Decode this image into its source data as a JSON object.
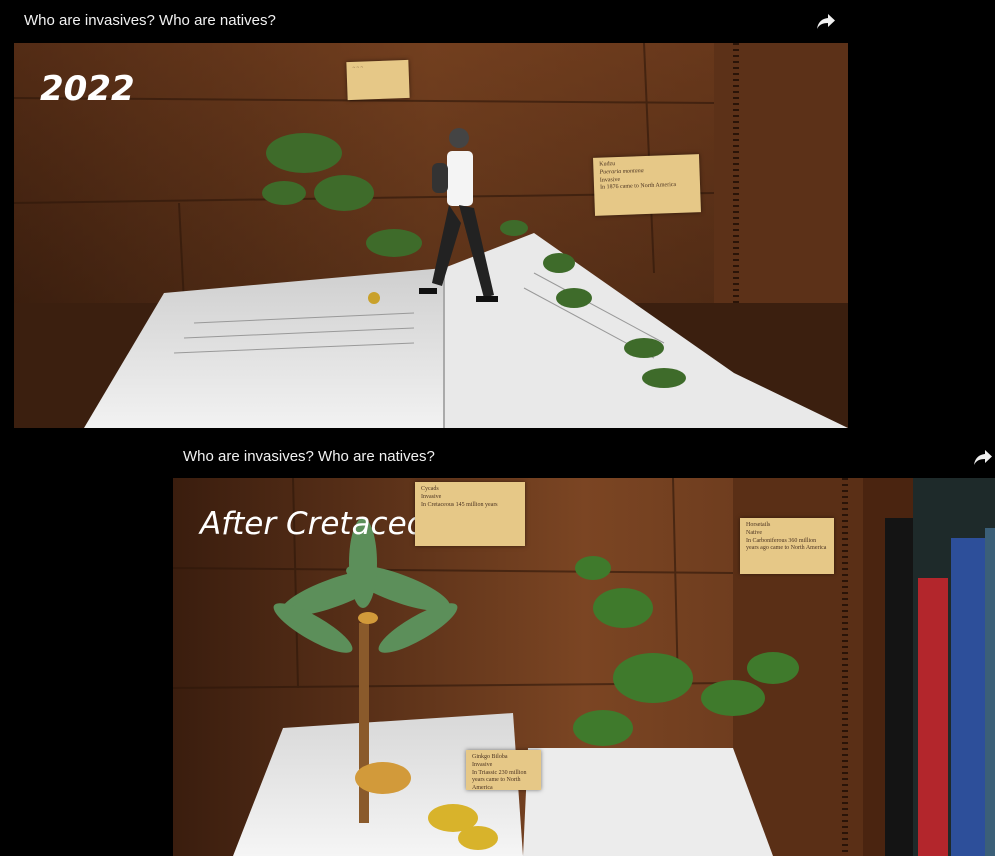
{
  "video1": {
    "title": "Who are invasives? Who are natives?",
    "overlay_text": "2022",
    "label_kudzu": [
      "Kudzu",
      "Pueraria montana",
      "Invasive",
      "In 1876 came to North America"
    ]
  },
  "video2": {
    "title": "Who are invasives? Who are natives?",
    "overlay_text": "After Cretaceous",
    "label_cycads": [
      "Cycads",
      "Invasive",
      "In Cretaceous 145 million years"
    ],
    "label_horsetails": [
      "Horsetails",
      "Native",
      "In Carboniferous 360 million years ago came to North America"
    ],
    "label_ginkgo": [
      "Ginkgo Biloba",
      "Invasive",
      "In Triassic 230 million years came to North America"
    ]
  },
  "colors": {
    "background": "#000000",
    "title_text": "#f1f1f1",
    "label_paper": "#e6c887"
  },
  "icons": {
    "share": "share-arrow-icon"
  }
}
